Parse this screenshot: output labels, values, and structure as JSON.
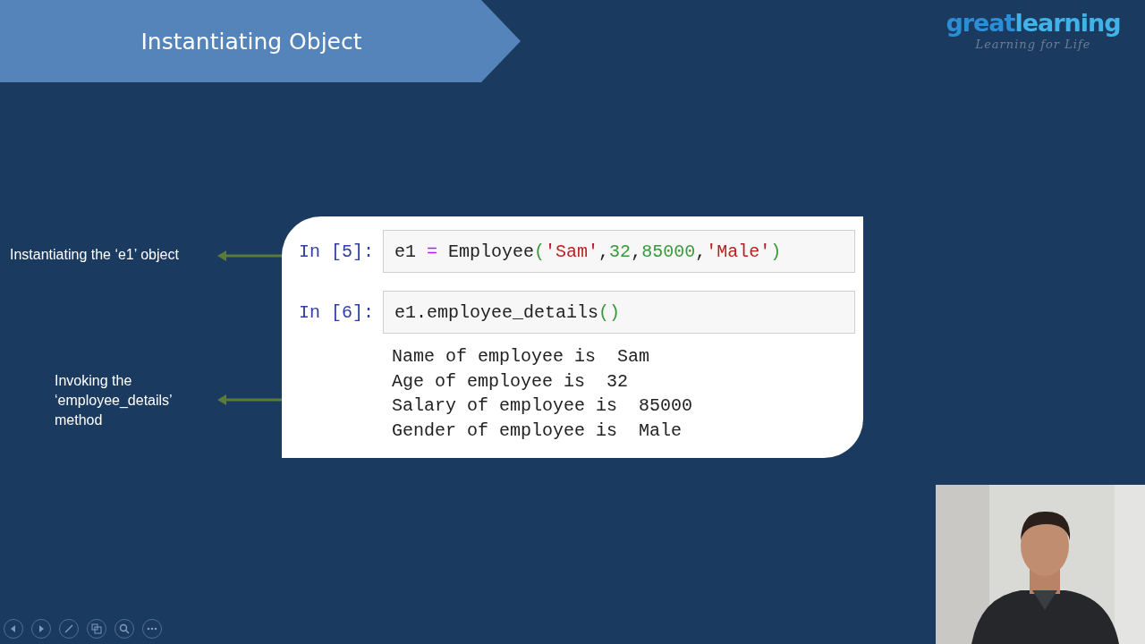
{
  "slide": {
    "title": "Instantiating Object"
  },
  "logo": {
    "brand": [
      "great",
      "learning"
    ],
    "tagline": "Learning for Life"
  },
  "annotations": [
    {
      "text": "Instantiating the ‘e1’ object"
    },
    {
      "text": "Invoking the ‘employee_details’ method"
    }
  ],
  "notebook": {
    "cells": [
      {
        "prompt": "In [5]:",
        "code": [
          {
            "kind": "name",
            "text": "e1 "
          },
          {
            "kind": "operator",
            "text": "="
          },
          {
            "kind": "name",
            "text": " Employee"
          },
          {
            "kind": "bracket",
            "text": "("
          },
          {
            "kind": "string",
            "text": "'Sam'"
          },
          {
            "kind": "name",
            "text": ","
          },
          {
            "kind": "number",
            "text": "32"
          },
          {
            "kind": "name",
            "text": ","
          },
          {
            "kind": "number",
            "text": "85000"
          },
          {
            "kind": "name",
            "text": ","
          },
          {
            "kind": "string",
            "text": "'Male'"
          },
          {
            "kind": "bracket",
            "text": ")"
          }
        ]
      },
      {
        "prompt": "In [6]:",
        "code": [
          {
            "kind": "name",
            "text": "e1.employee_details"
          },
          {
            "kind": "bracket",
            "text": "()"
          }
        ],
        "output": [
          "Name of employee is  Sam",
          "Age of employee is  32",
          "Salary of employee is  85000",
          "Gender of employee is  Male"
        ]
      }
    ]
  },
  "slideshow_controls": [
    {
      "kind": "previous"
    },
    {
      "kind": "next"
    },
    {
      "kind": "pen"
    },
    {
      "kind": "slides"
    },
    {
      "kind": "zoom"
    },
    {
      "kind": "more"
    }
  ]
}
